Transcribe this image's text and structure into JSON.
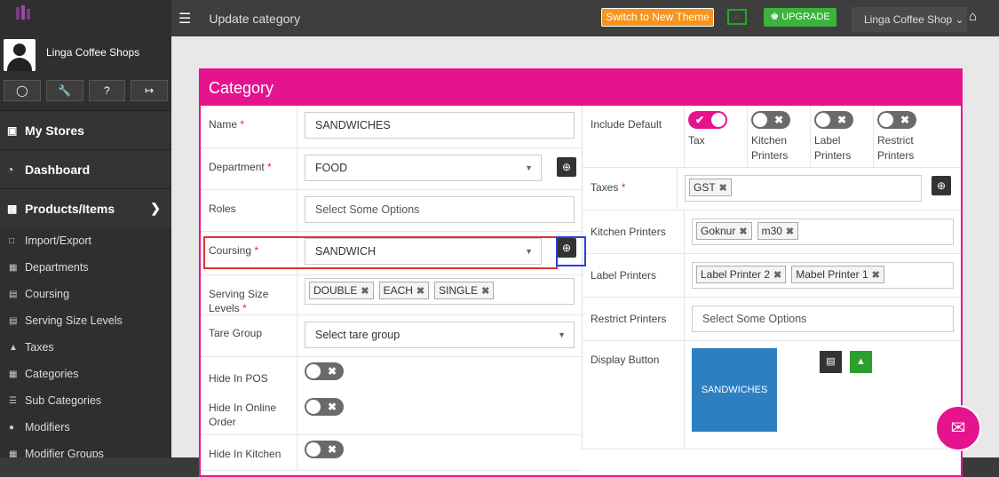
{
  "topbar": {
    "page_title": "Update category",
    "switch_theme_label": "Switch to New Theme",
    "upgrade_label": "UPGRADE",
    "store_selector": "Linga Coffee Shop"
  },
  "sidebar": {
    "store_name": "Linga Coffee Shops",
    "main_items": [
      {
        "label": "My Stores",
        "icon": "store-icon"
      },
      {
        "label": "Dashboard",
        "icon": "dashboard-icon"
      },
      {
        "label": "Products/Items",
        "icon": "gift-icon"
      }
    ],
    "sub_items": [
      {
        "label": "Import/Export"
      },
      {
        "label": "Departments"
      },
      {
        "label": "Coursing"
      },
      {
        "label": "Serving Size Levels"
      },
      {
        "label": "Taxes"
      },
      {
        "label": "Categories"
      },
      {
        "label": "Sub Categories"
      },
      {
        "label": "Modifiers"
      },
      {
        "label": "Modifier Groups"
      }
    ]
  },
  "form": {
    "card_title": "Category",
    "name_label": "Name",
    "name_value": "SANDWICHES",
    "department_label": "Department",
    "department_value": "FOOD",
    "roles_label": "Roles",
    "roles_placeholder": "Select Some Options",
    "coursing_label": "Coursing",
    "coursing_value": "SANDWICH",
    "serving_label": "Serving Size Levels",
    "serving_tags": [
      "DOUBLE",
      "EACH",
      "SINGLE"
    ],
    "tare_label": "Tare Group",
    "tare_placeholder": "Select tare group",
    "hide_pos_label": "Hide In POS",
    "hide_online_label": "Hide In Online Order",
    "hide_kitchen_label": "Hide In Kitchen",
    "include_default_label": "Include Default",
    "include_options": [
      {
        "label": "Tax",
        "on": true
      },
      {
        "label": "Kitchen Printers",
        "on": false
      },
      {
        "label": "Label Printers",
        "on": false
      },
      {
        "label": "Restrict Printers",
        "on": false
      }
    ],
    "taxes_label": "Taxes",
    "taxes_tags": [
      "GST"
    ],
    "kitchen_printers_label": "Kitchen Printers",
    "kitchen_tags": [
      "Goknur",
      "m30"
    ],
    "label_printers_label": "Label Printers",
    "label_tags": [
      "Label Printer 2",
      "Mabel Printer 1"
    ],
    "restrict_printers_label": "Restrict Printers",
    "restrict_placeholder": "Select Some Options",
    "display_button_label": "Display Button",
    "display_button_text": "SANDWICHES"
  },
  "colors": {
    "accent": "#e6138f",
    "display_button": "#2c7fc1",
    "upgrade": "#3cb33c",
    "theme_button": "#f7941d"
  }
}
